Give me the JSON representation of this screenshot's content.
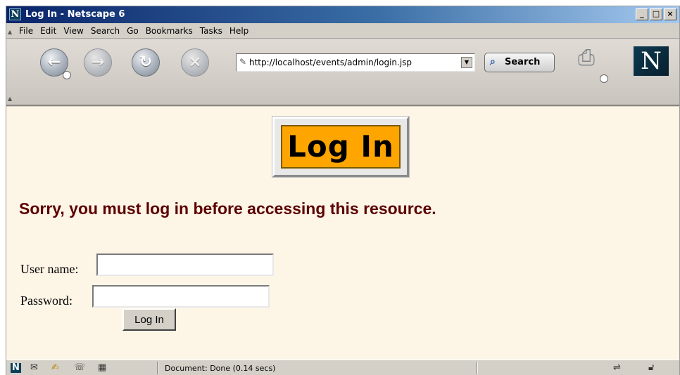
{
  "window": {
    "title": "Log In - Netscape 6",
    "app_icon": "N",
    "controls": {
      "minimize": "_",
      "maximize": "□",
      "close": "×"
    }
  },
  "menu": {
    "items": [
      "File",
      "Edit",
      "View",
      "Search",
      "Go",
      "Bookmarks",
      "Tasks",
      "Help"
    ]
  },
  "toolbar": {
    "back_glyph": "←",
    "forward_glyph": "→",
    "reload_glyph": "↻",
    "stop_glyph": "×",
    "url": "http://localhost/events/admin/login.jsp",
    "search_label": "Search",
    "logo_letter": "N"
  },
  "page": {
    "heading": "Log In",
    "message": "Sorry, you must log in before accessing this resource.",
    "username_label": "User name:",
    "password_label": "Password:",
    "submit_label": "Log In",
    "heading_bg_color": "#ffa500",
    "message_color": "#5c0000",
    "page_bg_color": "#fdf5e6"
  },
  "status": {
    "text": "Document: Done (0.14 secs)"
  },
  "icons": {
    "status_icons": [
      "netscape-icon",
      "mail-icon",
      "composer-icon",
      "address-book-icon",
      "chat-icon"
    ],
    "right_icons": [
      "connection-icon",
      "security-lock-icon"
    ]
  }
}
